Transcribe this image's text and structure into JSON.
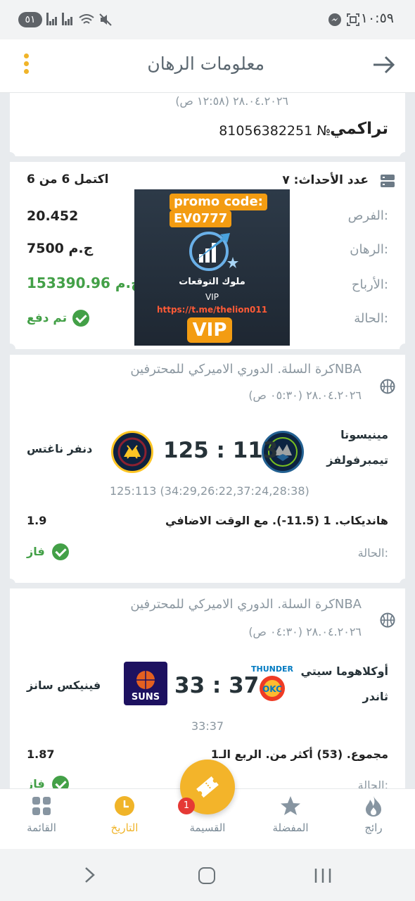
{
  "status_bar": {
    "battery": "٥١",
    "time": "١٠:٥٩"
  },
  "header": {
    "title": "معلومات الرهان",
    "back_icon": "arrow-right-icon",
    "menu_icon": "kebab-menu-icon"
  },
  "bet": {
    "date": "٢٨.٠٤.٢٠٢٦ (١٢:٥٨ ص)",
    "type": "تراكمي",
    "number": "81056382251 №",
    "events_label": "عدد الأحداث: ٧",
    "completed": "اكتمل 6 من 6",
    "odds_label": "الفرص:",
    "odds_value": "20.452",
    "stake_label": "الرهان:",
    "stake_value": "7500 ج.م",
    "winnings_label": "الأرباح:",
    "winnings_value": "153390.96 ج.م",
    "status_label": "الحالة:",
    "status_value": "تم دفع"
  },
  "promo": {
    "line1": "promo code:",
    "line2": "EV0777",
    "brand": "ملوك التوقعات",
    "tier": "VIP",
    "link": "https://t.me/thelion011",
    "badge": "VIP"
  },
  "events": [
    {
      "league": "كرة السلة. الدوري الاميركي للمحترفينNBA",
      "date": "٢٨.٠٤.٢٠٢٦ (٠٥:٣٠ ص)",
      "home_line1": "مينيسوتا",
      "home_line2": "تيمبرفولفز",
      "away": "دنفر ناغتس",
      "score": "125 : 113",
      "detail": "125:113 (34:29,26:22,37:24,28:38)",
      "market": "هانديكاب. 1 (11.5-). مع الوقت الاضافي",
      "odds": "1.9",
      "status_label": "الحالة:",
      "status_value": "فاز"
    },
    {
      "league": "كرة السلة. الدوري الاميركي للمحترفينNBA",
      "date": "٢٨.٠٤.٢٠٢٦ (٠٤:٣٠ ص)",
      "home_line1": "أوكلاهوما سيتي",
      "home_line2": "ثاندر",
      "away": "فينيكس سانز",
      "score": "33 : 37",
      "detail": "33:37",
      "market": "مجموع. (53) أكثر من. الربع الـ1",
      "odds": "1.87",
      "status_label": "الحالة:",
      "status_value": "فاز"
    }
  ],
  "bottom_nav": {
    "items": [
      {
        "label": "رائج",
        "icon": "flame-icon"
      },
      {
        "label": "المفضلة",
        "icon": "star-icon"
      },
      {
        "label": "القسيمة",
        "icon": "ticket-icon",
        "badge": "1"
      },
      {
        "label": "التاريخ",
        "icon": "clock-icon"
      },
      {
        "label": "القائمة",
        "icon": "grid-icon"
      }
    ],
    "active_color": "#f0b429"
  }
}
